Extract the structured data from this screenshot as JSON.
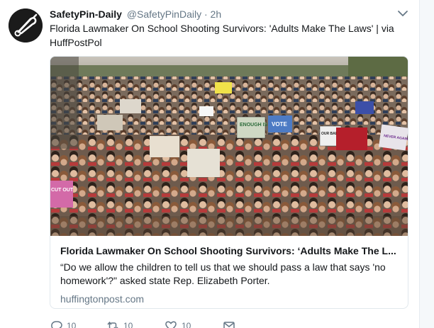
{
  "tweet": {
    "display_name": "SafetyPin-Daily",
    "handle": "@SafetyPinDaily",
    "separator": "·",
    "time": "2h",
    "text": "Florida Lawmaker On School Shooting Survivors: 'Adults Make The Laws' | via HuffPostPol"
  },
  "card": {
    "title": "Florida Lawmaker On School Shooting Survivors: ‘Adults Make The L...",
    "description": "“Do we allow the children to tell us that we should pass a law that says 'no homework'?\" asked state Rep. Elizabeth Porter.",
    "domain": "huffingtonpost.com",
    "image_signs": [
      "ENOUGH IS ENOUGH",
      "VOTE",
      "OUR BALLOTS",
      "NEVER AGAIN",
      "CUT OUT"
    ]
  },
  "actions": {
    "reply_count": "10",
    "retweet_count": "10",
    "like_count": "10"
  },
  "icons": [
    "safety-pin-avatar-icon",
    "chevron-down-icon",
    "reply-icon",
    "retweet-icon",
    "like-icon",
    "direct-message-icon"
  ],
  "colors": {
    "text": "#14171a",
    "secondary": "#657786",
    "border": "#e1e8ed"
  }
}
